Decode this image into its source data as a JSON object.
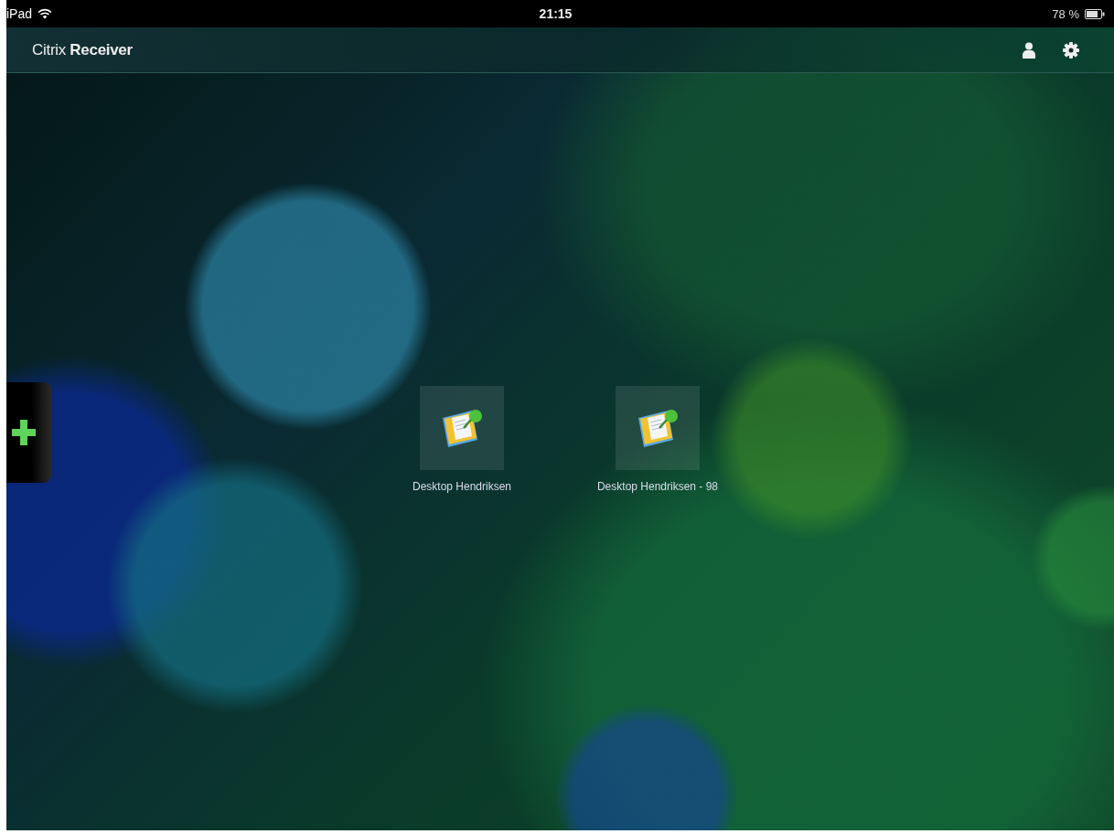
{
  "status_bar": {
    "device": "iPad",
    "time": "21:15",
    "battery": "78 %"
  },
  "header": {
    "logo": "Citrix **Receiver**"
  },
  "apps": [
    {
      "label": "Desktop Hendriksen"
    },
    {
      "label": "Desktop Hendriksen - 98"
    }
  ]
}
